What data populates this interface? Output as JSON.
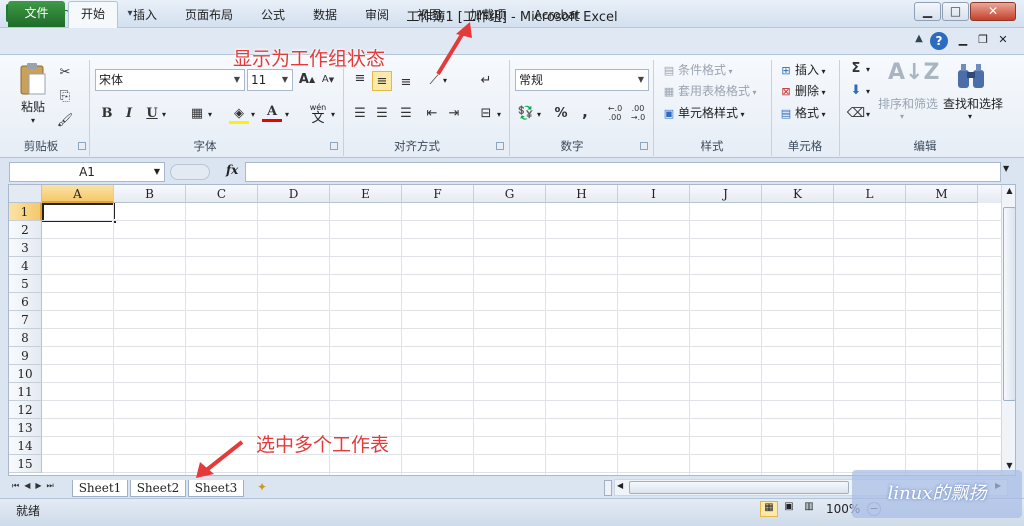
{
  "title": "工作簿1  [工作组] - Microsoft Excel",
  "tabs": {
    "file": "文件",
    "items": [
      "开始",
      "插入",
      "页面布局",
      "公式",
      "数据",
      "审阅",
      "视图",
      "加载项",
      "Acrobat"
    ]
  },
  "clipboard": {
    "paste": "粘贴",
    "group": "剪贴板"
  },
  "font": {
    "name": "宋体",
    "size": "11",
    "group": "字体",
    "bold": "B",
    "italic": "I",
    "underline": "U",
    "color_a": "A",
    "wen": "wén",
    "wen2": "文"
  },
  "alignment": {
    "group": "对齐方式"
  },
  "number": {
    "format": "常规",
    "group": "数字",
    "percent": "%",
    "comma": ","
  },
  "styles": {
    "conditional": "条件格式",
    "table": "套用表格格式",
    "cell": "单元格样式",
    "group": "样式"
  },
  "cells": {
    "insert": "插入",
    "delete": "删除",
    "format": "格式",
    "group": "单元格"
  },
  "editing": {
    "sigma": "Σ",
    "sort": "排序和筛选",
    "find": "查找和选择",
    "group": "编辑"
  },
  "formula_bar": {
    "name_box": "A1",
    "fx": "fx"
  },
  "columns": [
    "A",
    "B",
    "C",
    "D",
    "E",
    "F",
    "G",
    "H",
    "I",
    "J",
    "K",
    "L",
    "M"
  ],
  "rows": [
    "1",
    "2",
    "3",
    "4",
    "5",
    "6",
    "7",
    "8",
    "9",
    "10",
    "11",
    "12",
    "13",
    "14",
    "15"
  ],
  "sheets": [
    "Sheet1",
    "Sheet2",
    "Sheet3"
  ],
  "status": {
    "ready": "就绪",
    "zoom": "100%"
  },
  "annotations": {
    "workgroup": "显示为工作组状态",
    "select_sheets": "选中多个工作表"
  },
  "watermark": "linux的飘扬",
  "colors": {
    "file_tab": "#2e7d32",
    "annotation": "#e43a3a",
    "accent": "#1f4e99"
  },
  "icons": [
    "excel-icon",
    "save-icon",
    "undo-icon",
    "redo-icon",
    "paste-icon",
    "cut-icon",
    "copy-icon",
    "format-painter-icon",
    "help-icon",
    "sort-filter-icon",
    "find-icon"
  ]
}
